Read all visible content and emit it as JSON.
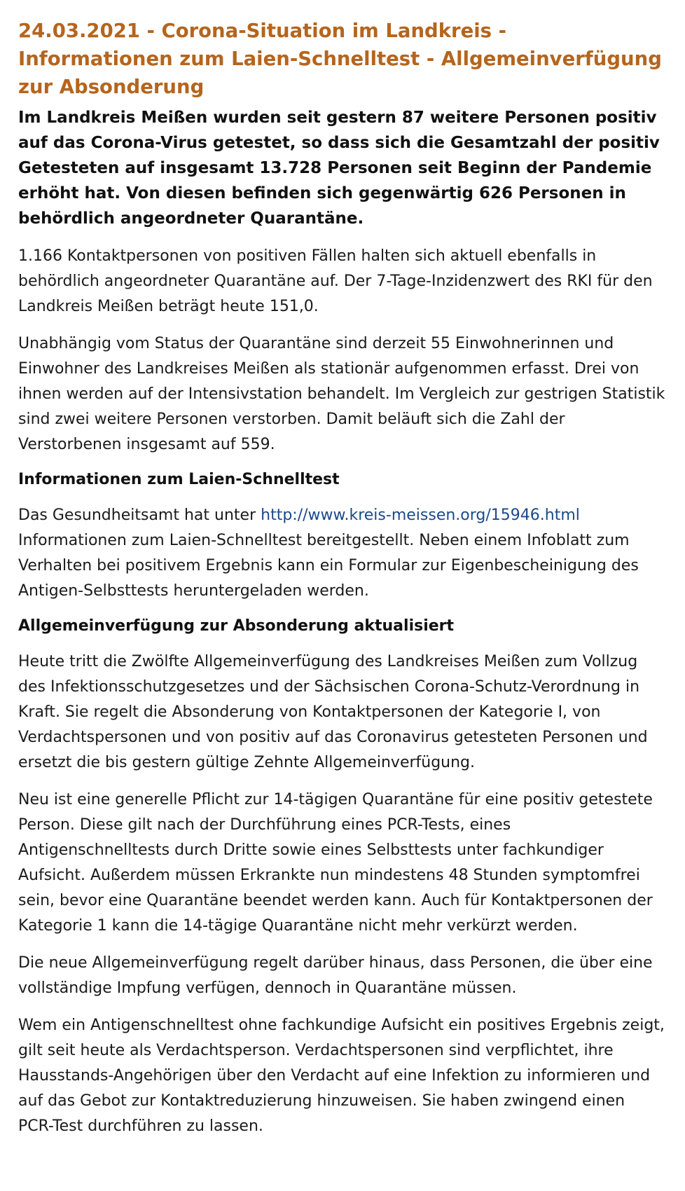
{
  "article": {
    "headline": "24.03.2021 - Corona-Situation im Landkreis - Informationen zum Laien-Schnelltest - Allgemeinverfügung zur Absonderung",
    "lead": "Im Landkreis Meißen wurden seit gestern 87 weitere Personen positiv auf das Corona-Virus getestet, so dass sich die Gesamtzahl der positiv Getesteten auf insgesamt 13.728 Personen seit Beginn der Pandemie erhöht hat. Von diesen befinden sich gegenwärtig 626 Personen in behördlich angeordneter Quarantäne.",
    "paragraph_1": "1.166 Kontaktpersonen von positiven Fällen halten sich aktuell ebenfalls in behördlich angeordneter Quarantäne auf. Der 7-Tage-Inzidenzwert des RKI für den Landkreis Meißen beträgt heute 151,0.",
    "paragraph_2": "Unabhängig vom Status der Quarantäne sind derzeit 55 Einwohnerinnen und Einwohner des Landkreises Meißen als stationär aufgenommen erfasst. Drei von ihnen werden auf der Intensivstation behandelt. Im Vergleich zur gestrigen Statistik sind zwei weitere Personen verstorben. Damit beläuft sich die Zahl der Verstorbenen insgesamt auf 559.",
    "section_schnelltest": {
      "heading": "Informationen zum Laien-Schnelltest",
      "text_before_link": "Das Gesundheitsamt hat unter ",
      "link_text": "http://www.kreis-meissen.org/15946.html",
      "text_after_link": " Informationen zum Laien-Schnelltest bereitgestellt. Neben einem Infoblatt zum Verhalten bei positivem Ergebnis kann ein Formular zur Eigenbescheinigung des Antigen-Selbsttests heruntergeladen werden."
    },
    "section_absonderung": {
      "heading": "Allgemeinverfügung zur Absonderung aktualisiert",
      "paragraph_1": "Heute tritt die Zwölfte Allgemeinverfügung des Landkreises Meißen zum Vollzug des Infektionsschutzgesetzes und der Sächsischen Corona-Schutz-Verordnung in Kraft. Sie regelt die Absonderung von Kontaktpersonen der Kategorie I, von Verdachtspersonen und von positiv auf das Coronavirus getesteten Personen und ersetzt die bis gestern gültige Zehnte Allgemeinverfügung.",
      "paragraph_2": "Neu ist eine generelle Pflicht zur 14-tägigen Quarantäne für eine positiv getestete Person. Diese gilt nach der Durchführung eines PCR-Tests, eines Antigenschnelltests durch Dritte sowie eines Selbsttests unter fachkundiger Aufsicht. Außerdem müssen Erkrankte nun mindestens 48 Stunden symptomfrei sein, bevor eine Quarantäne beendet werden kann. Auch für Kontaktpersonen der Kategorie 1 kann die 14-tägige Quarantäne nicht mehr verkürzt werden.",
      "paragraph_3": "Die neue Allgemeinverfügung regelt darüber hinaus, dass Personen, die über eine vollständige Impfung verfügen, dennoch in Quarantäne müssen.",
      "paragraph_4": "Wem ein Antigenschnelltest ohne fachkundige Aufsicht ein positives Ergebnis zeigt, gilt seit heute als Verdachtsperson. Verdachtspersonen sind verpflichtet, ihre Hausstands-Angehörigen über den Verdacht auf eine Infektion zu informieren und auf das Gebot zur Kontaktreduzierung hinzuweisen. Sie haben zwingend einen PCR-Test durchführen zu lassen."
    }
  }
}
